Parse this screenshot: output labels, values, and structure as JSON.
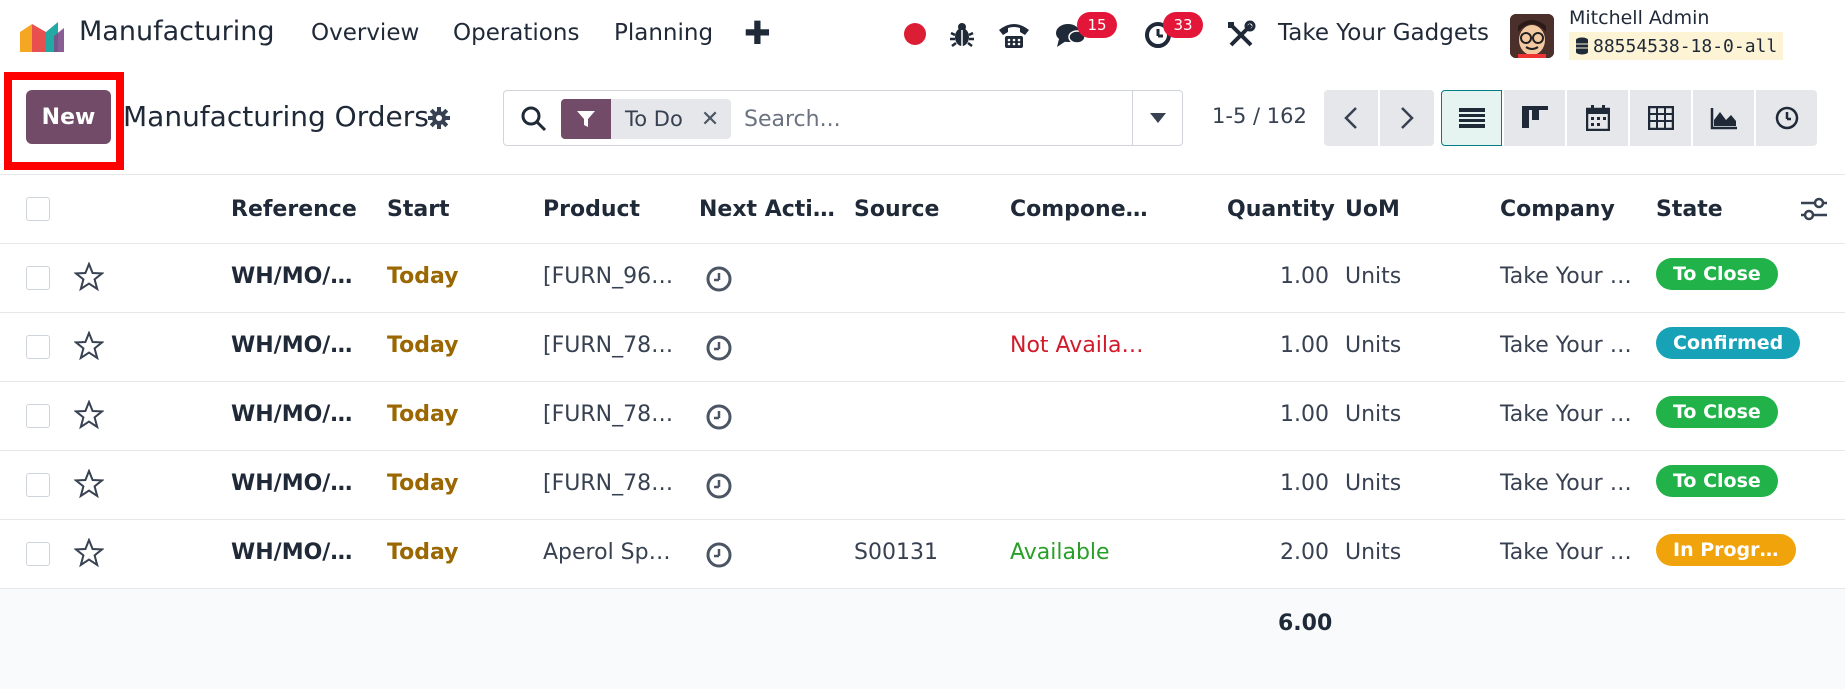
{
  "navbar": {
    "app_name": "Manufacturing",
    "menus": [
      "Overview",
      "Operations",
      "Planning"
    ],
    "plus": "✚",
    "messages_count": "15",
    "activities_count": "33",
    "company": "Take Your Gadgets",
    "user_name": "Mitchell Admin",
    "database": "88554538-18-0-all"
  },
  "control": {
    "new_label": "New",
    "title": "Manufacturing Orders",
    "facet_label": "To Do",
    "facet_remove": "✕",
    "search_placeholder": "Search...",
    "pager": "1-5 / 162"
  },
  "table": {
    "columns": [
      "Reference",
      "Start",
      "Product",
      "Next Acti…",
      "Source",
      "Compone…",
      "Quantity",
      "UoM",
      "Company",
      "State"
    ],
    "rows": [
      {
        "reference": "WH/MO/…",
        "start": "Today",
        "product": "[FURN_96…",
        "source": "",
        "components": "",
        "quantity": "1.00",
        "uom": "Units",
        "company": "Take Your …",
        "state": "To Close"
      },
      {
        "reference": "WH/MO/…",
        "start": "Today",
        "product": "[FURN_78…",
        "source": "",
        "components": "Not Availa…",
        "quantity": "1.00",
        "uom": "Units",
        "company": "Take Your …",
        "state": "Confirmed"
      },
      {
        "reference": "WH/MO/…",
        "start": "Today",
        "product": "[FURN_78…",
        "source": "",
        "components": "",
        "quantity": "1.00",
        "uom": "Units",
        "company": "Take Your …",
        "state": "To Close"
      },
      {
        "reference": "WH/MO/…",
        "start": "Today",
        "product": "[FURN_78…",
        "source": "",
        "components": "",
        "quantity": "1.00",
        "uom": "Units",
        "company": "Take Your …",
        "state": "To Close"
      },
      {
        "reference": "WH/MO/…",
        "start": "Today",
        "product": "Aperol Sp…",
        "source": "S00131",
        "components": "Available",
        "quantity": "2.00",
        "uom": "Units",
        "company": "Take Your …",
        "state": "In Progr…"
      }
    ],
    "total_quantity": "6.00"
  },
  "colors": {
    "brand": "#714b67",
    "to_close": "#21b24a",
    "confirmed": "#17a2b8",
    "in_progress": "#f0a30a",
    "not_available": "#d11a2a",
    "available": "#28a028"
  }
}
